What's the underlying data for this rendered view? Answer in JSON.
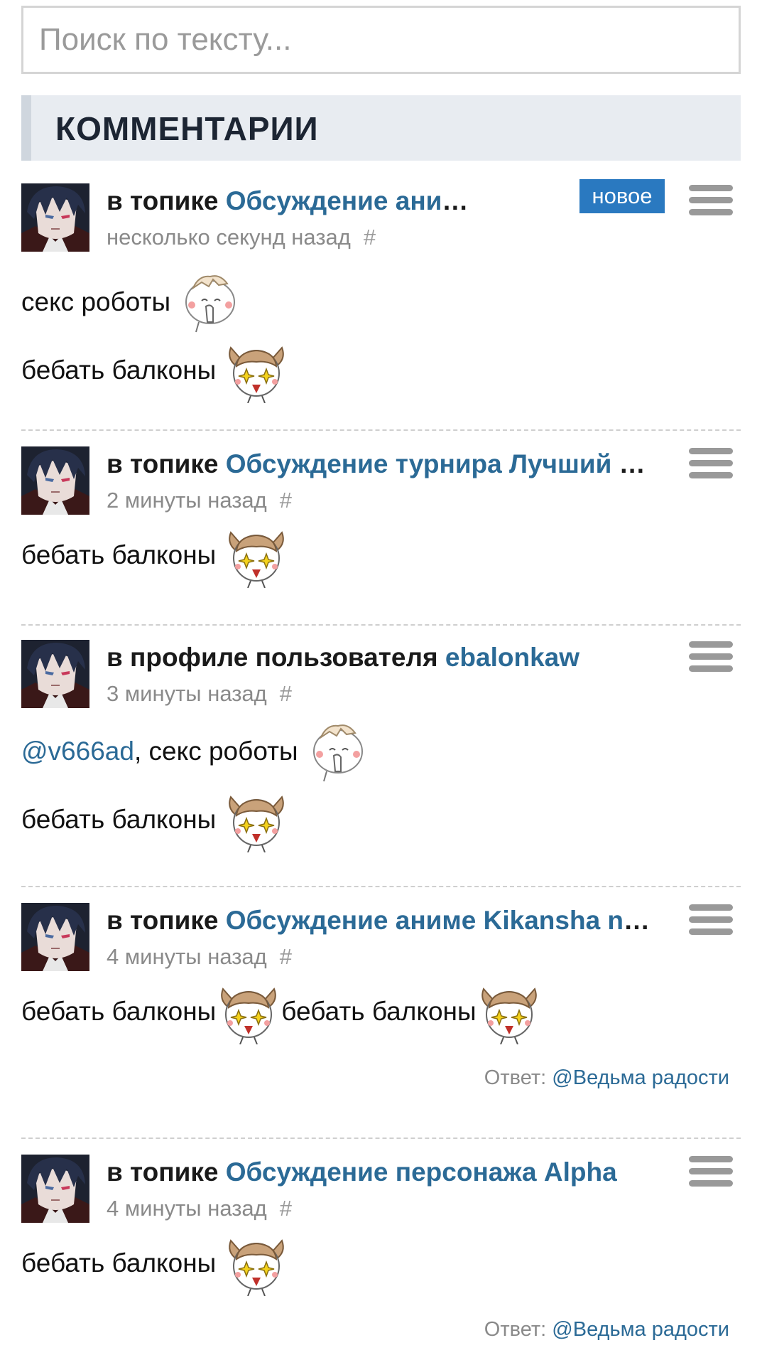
{
  "search": {
    "placeholder": "Поиск по тексту..."
  },
  "section": {
    "title": "КОММЕНТАРИИ"
  },
  "badge_new_label": "новое",
  "reply_prefix": "Ответ: ",
  "icons": {
    "menu": "hamburger-menu-icon",
    "emoji_smile": "blushing-face-sticker",
    "emoji_deer": "excited-deer-sticker"
  },
  "colors": {
    "link": "#2b6a96",
    "badge": "#2a79c0",
    "header_bg": "#e8ecf1"
  },
  "comments": [
    {
      "prefix": "в топике ",
      "target": "Обсуждение аниме Kikansha no Mahou wa Tokubetsu desu",
      "time": "несколько секунд назад",
      "hash": "#",
      "is_new": true,
      "lines": [
        {
          "text": "секс роботы",
          "emoji": "blushing-face-sticker"
        },
        {
          "text": "бебать балконы",
          "emoji": "excited-deer-sticker"
        }
      ]
    },
    {
      "prefix": "в топике ",
      "target": "Обсуждение турнира Лучший персонаж",
      "time": "2 минуты назад",
      "hash": "#",
      "lines": [
        {
          "text": "бебать балконы",
          "emoji": "excited-deer-sticker"
        }
      ]
    },
    {
      "prefix": "в профиле пользователя ",
      "target": "ebalonkaw",
      "time": "3 минуты назад",
      "hash": "#",
      "lines": [
        {
          "mention": "@v666ad",
          "text": ", секс роботы",
          "emoji": "blushing-face-sticker"
        },
        {
          "text": "бебать балконы",
          "emoji": "excited-deer-sticker"
        }
      ]
    },
    {
      "prefix": "в топике ",
      "target": "Обсуждение аниме Kikansha no Mahou wa Tokubetsu desu",
      "time": "4 минуты назад",
      "hash": "#",
      "lines": [
        {
          "text": "бебать балконы",
          "emoji": "excited-deer-sticker",
          "text2": "бебать балконы",
          "emoji2": "excited-deer-sticker"
        }
      ],
      "reply_to": "@Ведьма радости"
    },
    {
      "prefix": "в топике ",
      "target": "Обсуждение персонажа Alpha",
      "time": "4 минуты назад",
      "hash": "#",
      "lines": [
        {
          "text": "бебать балконы",
          "emoji": "excited-deer-sticker"
        }
      ],
      "reply_to": "@Ведьма радости"
    }
  ]
}
